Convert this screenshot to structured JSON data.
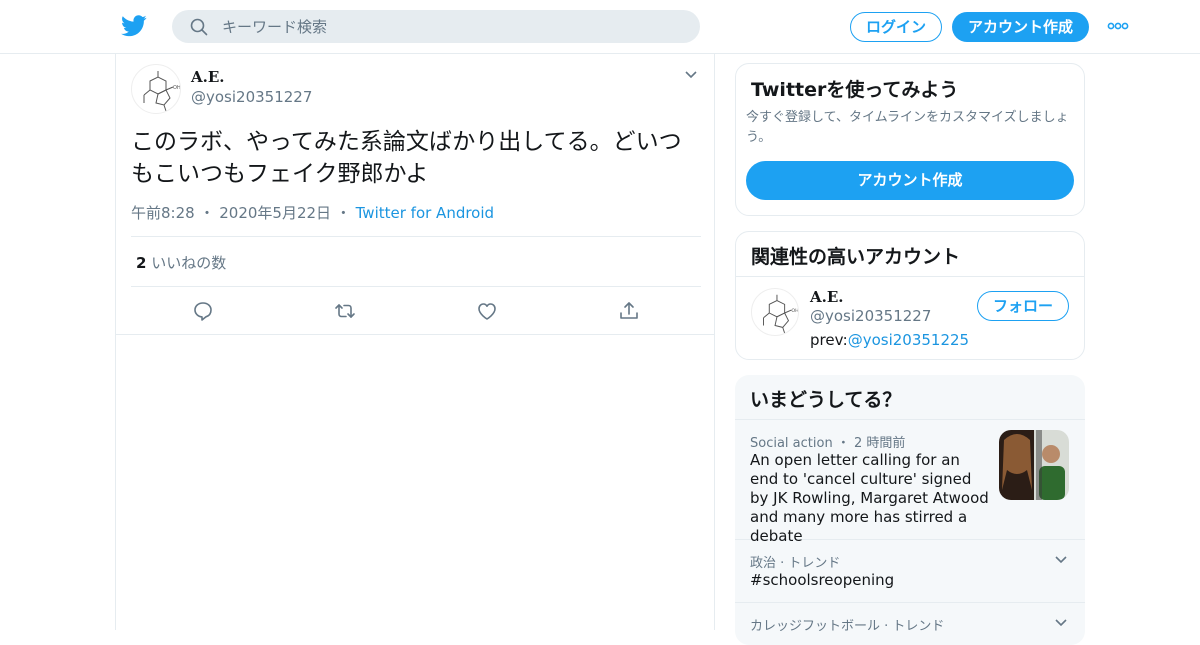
{
  "header": {
    "search_placeholder": "キーワード検索",
    "login_label": "ログイン",
    "signup_label": "アカウント作成"
  },
  "tweet": {
    "author_name": "A.E.",
    "author_handle": "@yosi20351227",
    "text": "このラボ、やってみた系論文ばかり出してる。どいつもこいつもフェイク野郎かよ",
    "time": "午前8:28",
    "date": "2020年5月22日",
    "source": "Twitter for Android",
    "likes_count": "2",
    "likes_label": "いいねの数"
  },
  "welcome_card": {
    "title": "Twitterを使ってみよう",
    "subtitle": "今すぐ登録して、タイムラインをカスタマイズしましょう。",
    "signup_label": "アカウント作成"
  },
  "related_card": {
    "title": "関連性の高いアカウント",
    "name": "A.E.",
    "handle": "@yosi20351227",
    "bio_prefix": "prev:",
    "bio_link": "@yosi20351225",
    "follow_label": "フォロー"
  },
  "trends_card": {
    "title": "いまどうしてる？",
    "items": [
      {
        "meta": "Social action ・ 2 時間前",
        "title": "An open letter calling for an end to 'cancel culture' signed by JK Rowling, Margaret Atwood and many more has stirred a debate"
      },
      {
        "meta": "政治 · トレンド",
        "title": "#schoolsreopening"
      },
      {
        "meta": "カレッジフットボール · トレンド",
        "title": ""
      }
    ]
  },
  "colors": {
    "brand": "#1da1f2",
    "link": "#1b95e0",
    "secondary_text": "#657786",
    "border": "#e6ecf0"
  },
  "icons": [
    "twitter-bird-icon",
    "search-icon",
    "more-dots-icon",
    "chevron-down-icon",
    "reply-icon",
    "retweet-icon",
    "like-heart-icon",
    "share-icon"
  ]
}
